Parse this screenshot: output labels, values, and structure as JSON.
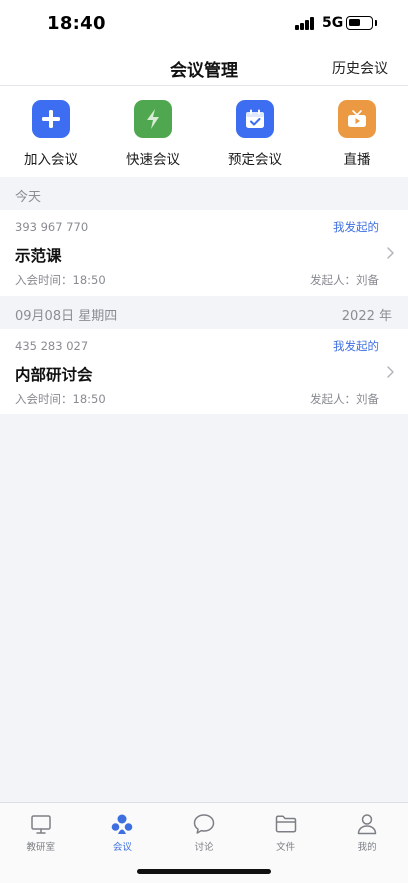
{
  "status_bar": {
    "time": "18:40",
    "network": "5G",
    "battery_level": 0.55
  },
  "nav": {
    "title": "会议管理",
    "history_label": "历史会议"
  },
  "quick_actions": [
    {
      "label": "加入会议",
      "icon": "plus-icon",
      "color": "#3d6ef2"
    },
    {
      "label": "快速会议",
      "icon": "lightning-icon",
      "color": "#4fa850"
    },
    {
      "label": "预定会议",
      "icon": "calendar-check-icon",
      "color": "#3d6ef2"
    },
    {
      "label": "直播",
      "icon": "tv-play-icon",
      "color": "#eb9a43"
    }
  ],
  "sections": [
    {
      "header_left": "今天",
      "header_right": "",
      "meetings": [
        {
          "id": "393 967 770",
          "tag": "我发起的",
          "title": "示范课",
          "time": "入会时间：18:50",
          "host": "发起人：刘备"
        }
      ]
    },
    {
      "header_left": "09月08日 星期四",
      "header_right": "2022 年",
      "meetings": [
        {
          "id": "435 283 027",
          "tag": "我发起的",
          "title": "内部研讨会",
          "time": "入会时间：18:50",
          "host": "发起人：刘备"
        }
      ]
    }
  ],
  "tab_bar": {
    "active": "会议",
    "items": [
      {
        "label": "教研室",
        "icon": "monitor-icon"
      },
      {
        "label": "会议",
        "icon": "meeting-people-icon"
      },
      {
        "label": "讨论",
        "icon": "chat-bubble-icon"
      },
      {
        "label": "文件",
        "icon": "folder-icon"
      },
      {
        "label": "我的",
        "icon": "user-icon"
      }
    ]
  },
  "colors": {
    "accent": "#3e6fe0",
    "section_bg": "#f3f4f8",
    "secondary_text": "#888b91"
  }
}
